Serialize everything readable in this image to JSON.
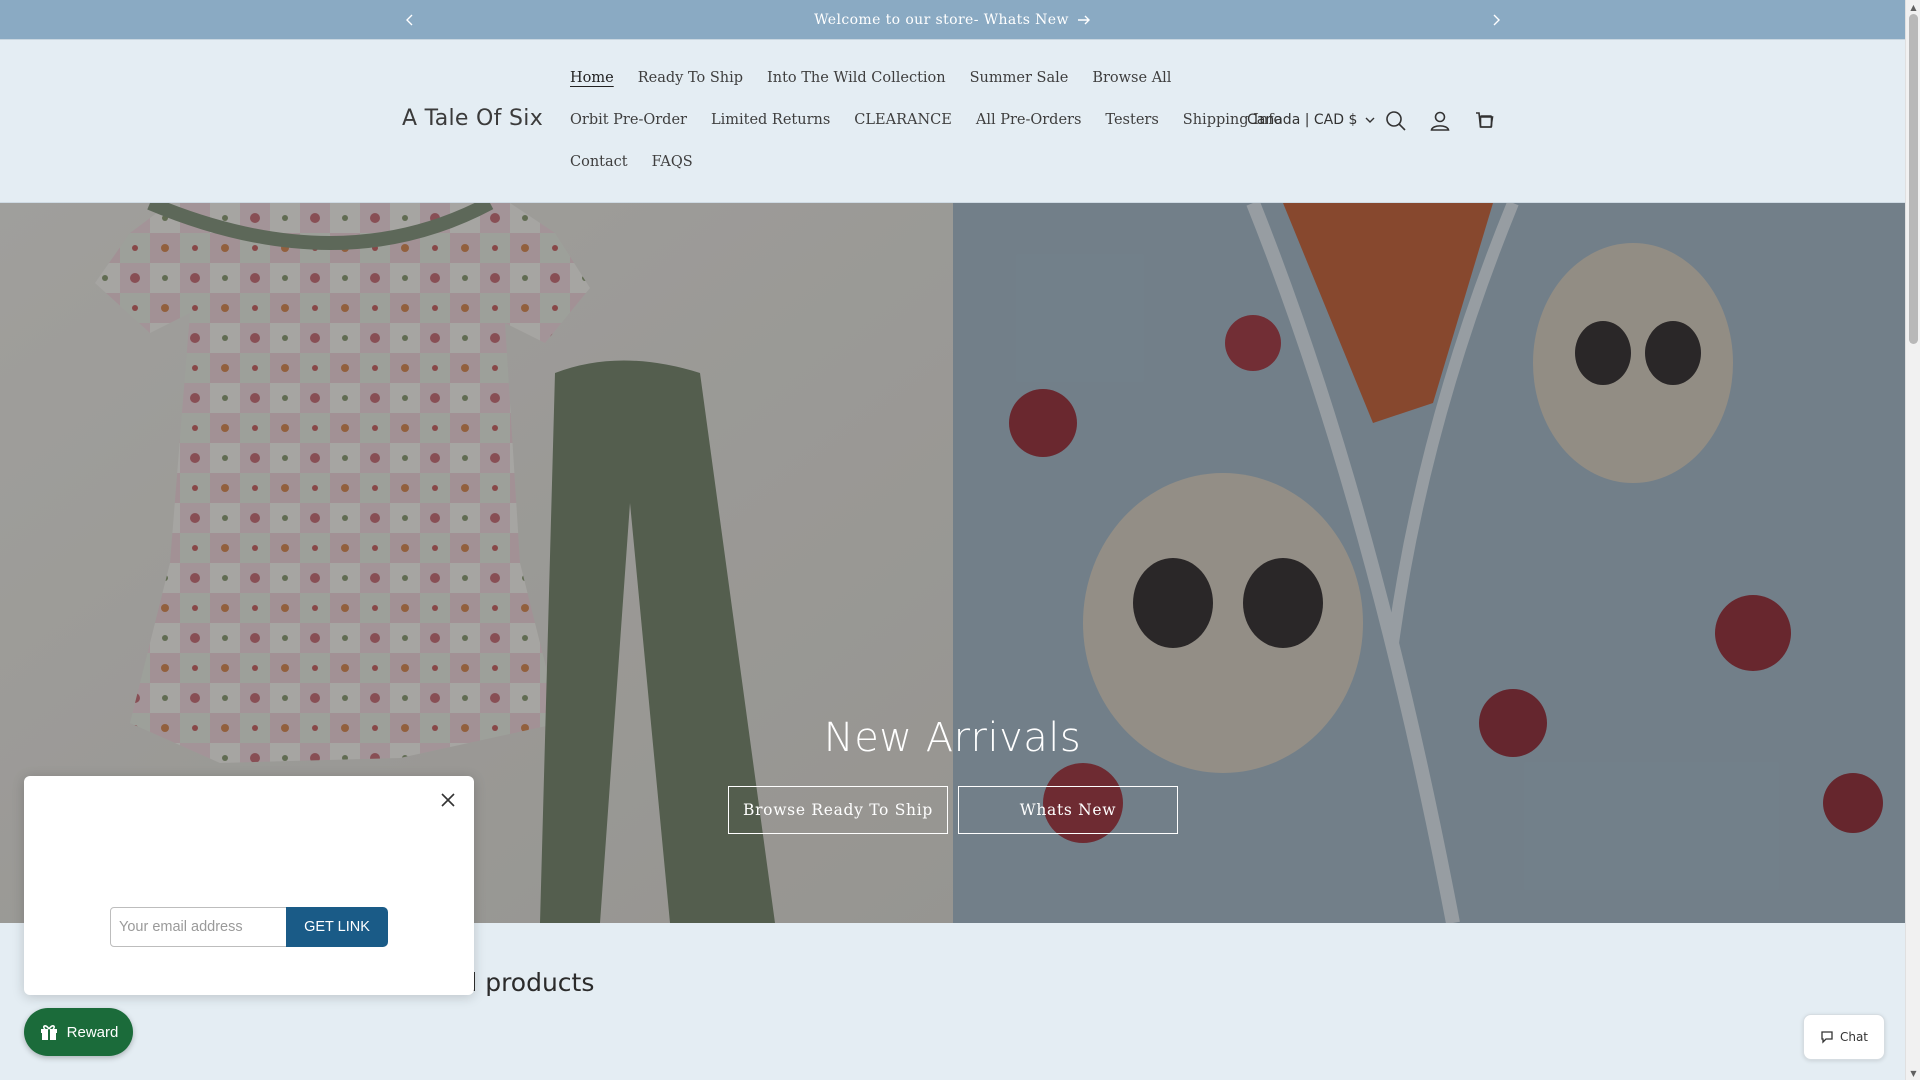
{
  "announcement": {
    "text": "Welcome to our store- Whats New",
    "prev_icon": "chevron-left-icon",
    "next_icon": "chevron-right-icon",
    "arrow_icon": "arrow-right-icon"
  },
  "header": {
    "logo": "A Tale Of Six",
    "nav_rows": [
      [
        "Home",
        "Ready To Ship",
        "Into The Wild Collection",
        "Summer Sale",
        "Browse All"
      ],
      [
        "Orbit Pre-Order",
        "Limited Returns",
        "CLEARANCE",
        "All Pre-Orders",
        "Testers",
        "Shipping Info"
      ],
      [
        "Contact",
        "FAQS"
      ]
    ],
    "active_item": "Home",
    "currency": "Canada | CAD $",
    "icons": [
      "search-icon",
      "account-icon",
      "cart-icon"
    ]
  },
  "hero": {
    "title": "New Arrivals",
    "buttons": [
      "Browse Ready To Ship",
      "Whats New"
    ]
  },
  "featured": {
    "title": "ed products"
  },
  "popup": {
    "email_placeholder": "Your email address",
    "button": "GET LINK"
  },
  "reward": {
    "label": "Reward"
  },
  "chat": {
    "label": "Chat"
  },
  "colors": {
    "announcement_bg": "#8aaac3",
    "header_bg": "#e4edf3",
    "get_link_bg": "#1a5b87",
    "reward_bg": "#1b6b3a"
  }
}
